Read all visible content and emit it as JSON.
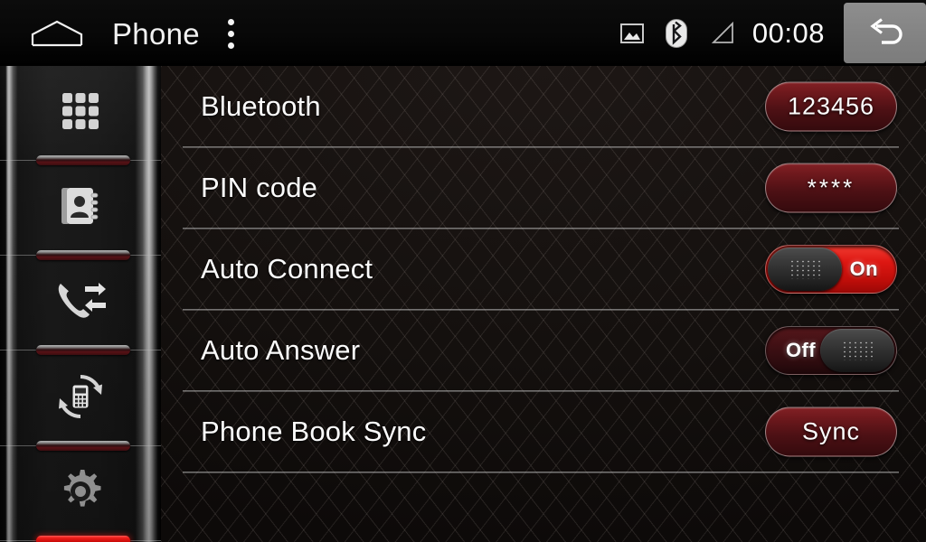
{
  "statusbar": {
    "home_icon": "home-icon",
    "title": "Phone",
    "overflow_icon": "overflow-menu-icon",
    "photo_icon": "image-icon",
    "bluetooth_icon": "bluetooth-icon",
    "signal_icon": "signal-triangle-icon",
    "clock": "00:08",
    "back_icon": "back-uturn-arrow-icon"
  },
  "sidebar": {
    "items": [
      {
        "name": "dialpad",
        "icon": "dialpad-icon",
        "active": false
      },
      {
        "name": "contacts",
        "icon": "contacts-book-icon",
        "active": false
      },
      {
        "name": "call-log",
        "icon": "call-log-icon",
        "active": false
      },
      {
        "name": "sync-phone",
        "icon": "phone-sync-icon",
        "active": false
      },
      {
        "name": "settings",
        "icon": "gear-icon",
        "active": true
      }
    ]
  },
  "main": {
    "rows": [
      {
        "label": "Bluetooth",
        "control": "button",
        "value": "123456"
      },
      {
        "label": "PIN code",
        "control": "button",
        "value": "****"
      },
      {
        "label": "Auto Connect",
        "control": "toggle",
        "value": "On"
      },
      {
        "label": "Auto Answer",
        "control": "toggle",
        "value": "Off"
      },
      {
        "label": "Phone Book Sync",
        "control": "button",
        "value": "Sync"
      }
    ]
  },
  "colors": {
    "accent_red": "#dd1712",
    "button_red": "#6d181c",
    "panel_bg": "#17120f",
    "statusbar_bg": "#0c0c0c",
    "text": "#fcfcfc",
    "back_button_gray": "#868686"
  }
}
